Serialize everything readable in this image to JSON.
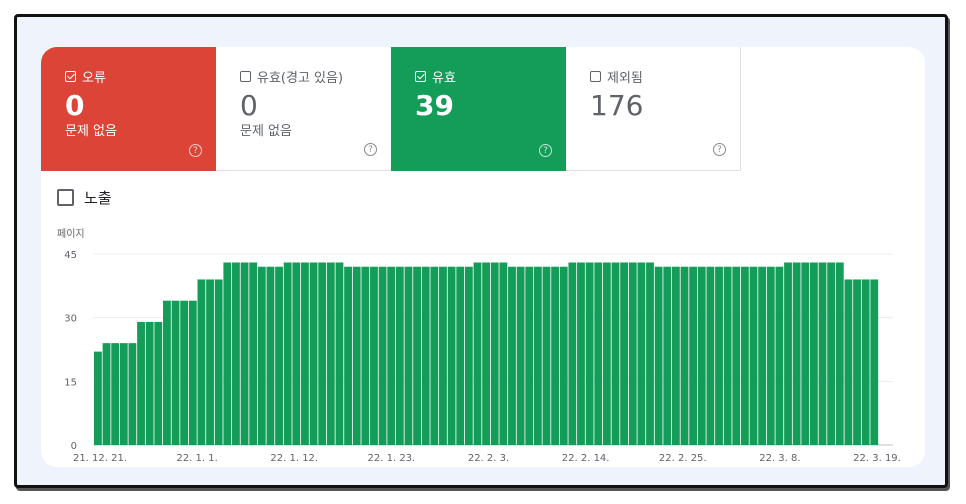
{
  "tiles": [
    {
      "key": "error",
      "label": "오류",
      "value": "0",
      "sub": "문제 없음",
      "checked": true
    },
    {
      "key": "warn",
      "label": "유효(경고 있음)",
      "value": "0",
      "sub": "문제 없음",
      "checked": false
    },
    {
      "key": "valid",
      "label": "유효",
      "value": "39",
      "sub": "",
      "checked": true
    },
    {
      "key": "excluded",
      "label": "제외됨",
      "value": "176",
      "sub": "",
      "checked": false
    }
  ],
  "help_glyph": "?",
  "impressions": {
    "label": "노출",
    "checked": false
  },
  "colors": {
    "error": "#db4437",
    "valid": "#139d58",
    "bar": "#139d58"
  },
  "chart_data": {
    "type": "bar",
    "ylabel": "페이지",
    "ylim": [
      0,
      45
    ],
    "yticks": [
      0,
      15,
      30,
      45
    ],
    "grid": true,
    "xtick_labels": [
      "21. 12. 21.",
      "22. 1. 1.",
      "22. 1. 12.",
      "22. 1. 23.",
      "22. 2. 3.",
      "22. 2. 14.",
      "22. 2. 25.",
      "22. 3. 8.",
      "22. 3. 19."
    ],
    "values": [
      22,
      24,
      24,
      24,
      24,
      29,
      29,
      29,
      34,
      34,
      34,
      34,
      39,
      39,
      39,
      43,
      43,
      43,
      43,
      42,
      42,
      42,
      43,
      43,
      43,
      43,
      43,
      43,
      43,
      42,
      42,
      42,
      42,
      42,
      42,
      42,
      42,
      42,
      42,
      42,
      42,
      42,
      42,
      42,
      43,
      43,
      43,
      43,
      42,
      42,
      42,
      42,
      42,
      42,
      42,
      43,
      43,
      43,
      43,
      43,
      43,
      43,
      43,
      43,
      43,
      42,
      42,
      42,
      42,
      42,
      42,
      42,
      42,
      42,
      42,
      42,
      42,
      42,
      42,
      42,
      43,
      43,
      43,
      43,
      43,
      43,
      43,
      39,
      39,
      39,
      39
    ]
  }
}
